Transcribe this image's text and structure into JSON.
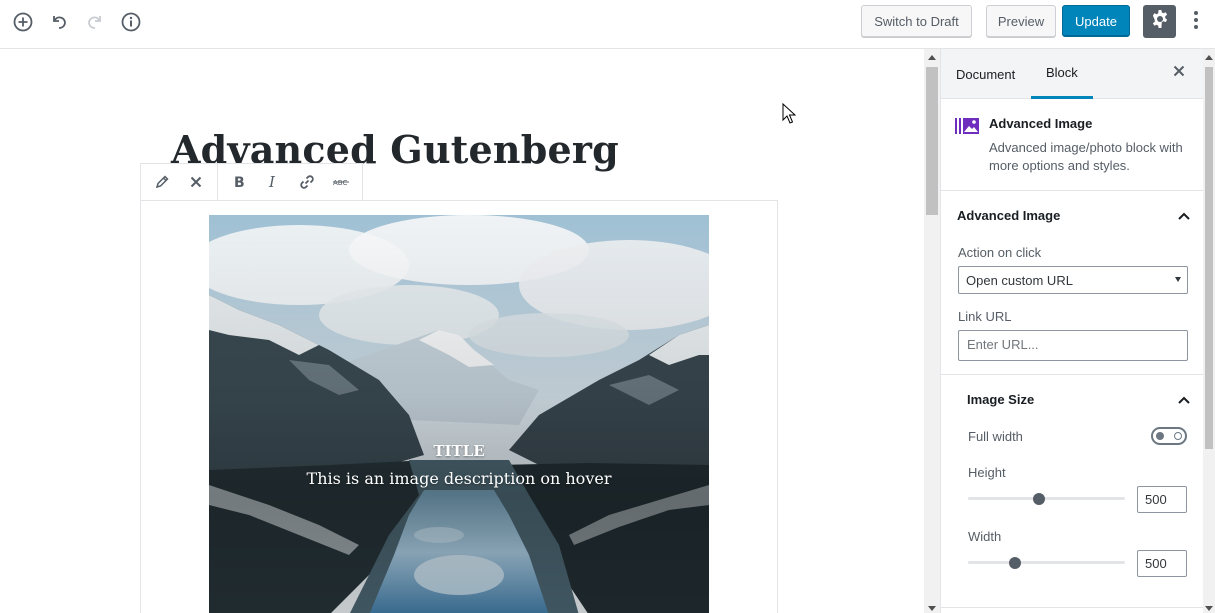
{
  "toolbar": {
    "switch_to_draft": "Switch to Draft",
    "preview": "Preview",
    "update": "Update",
    "icons": [
      "add-block-icon",
      "undo-icon",
      "redo-icon",
      "info-icon",
      "gear-icon",
      "more-vertical-icon"
    ]
  },
  "editor": {
    "post_title": "Advanced Gutenberg",
    "block_toolbar": [
      "pencil-icon",
      "close-icon",
      "bold-icon",
      "italic-icon",
      "link-icon",
      "strikethrough-icon"
    ],
    "image_overlay": {
      "title": "TITLE",
      "description": "This is an image description on hover"
    }
  },
  "sidebar": {
    "tabs": [
      "Document",
      "Block"
    ],
    "active_tab": "Block",
    "block_card": {
      "name": "Advanced Image",
      "description": "Advanced image/photo block with more options and styles."
    },
    "panel_advanced_image": {
      "title": "Advanced Image",
      "action_label": "Action on click",
      "action_value": "Open custom URL",
      "link_label": "Link URL",
      "link_placeholder": "Enter URL..."
    },
    "panel_image_size": {
      "title": "Image Size",
      "full_width_label": "Full width",
      "full_width": false,
      "height_label": "Height",
      "height_value": "500",
      "width_label": "Width",
      "width_value": "500"
    }
  },
  "colors": {
    "primary": "#0085ba",
    "dark_button": "#555d66",
    "block_icon": "#6f2dbd"
  }
}
